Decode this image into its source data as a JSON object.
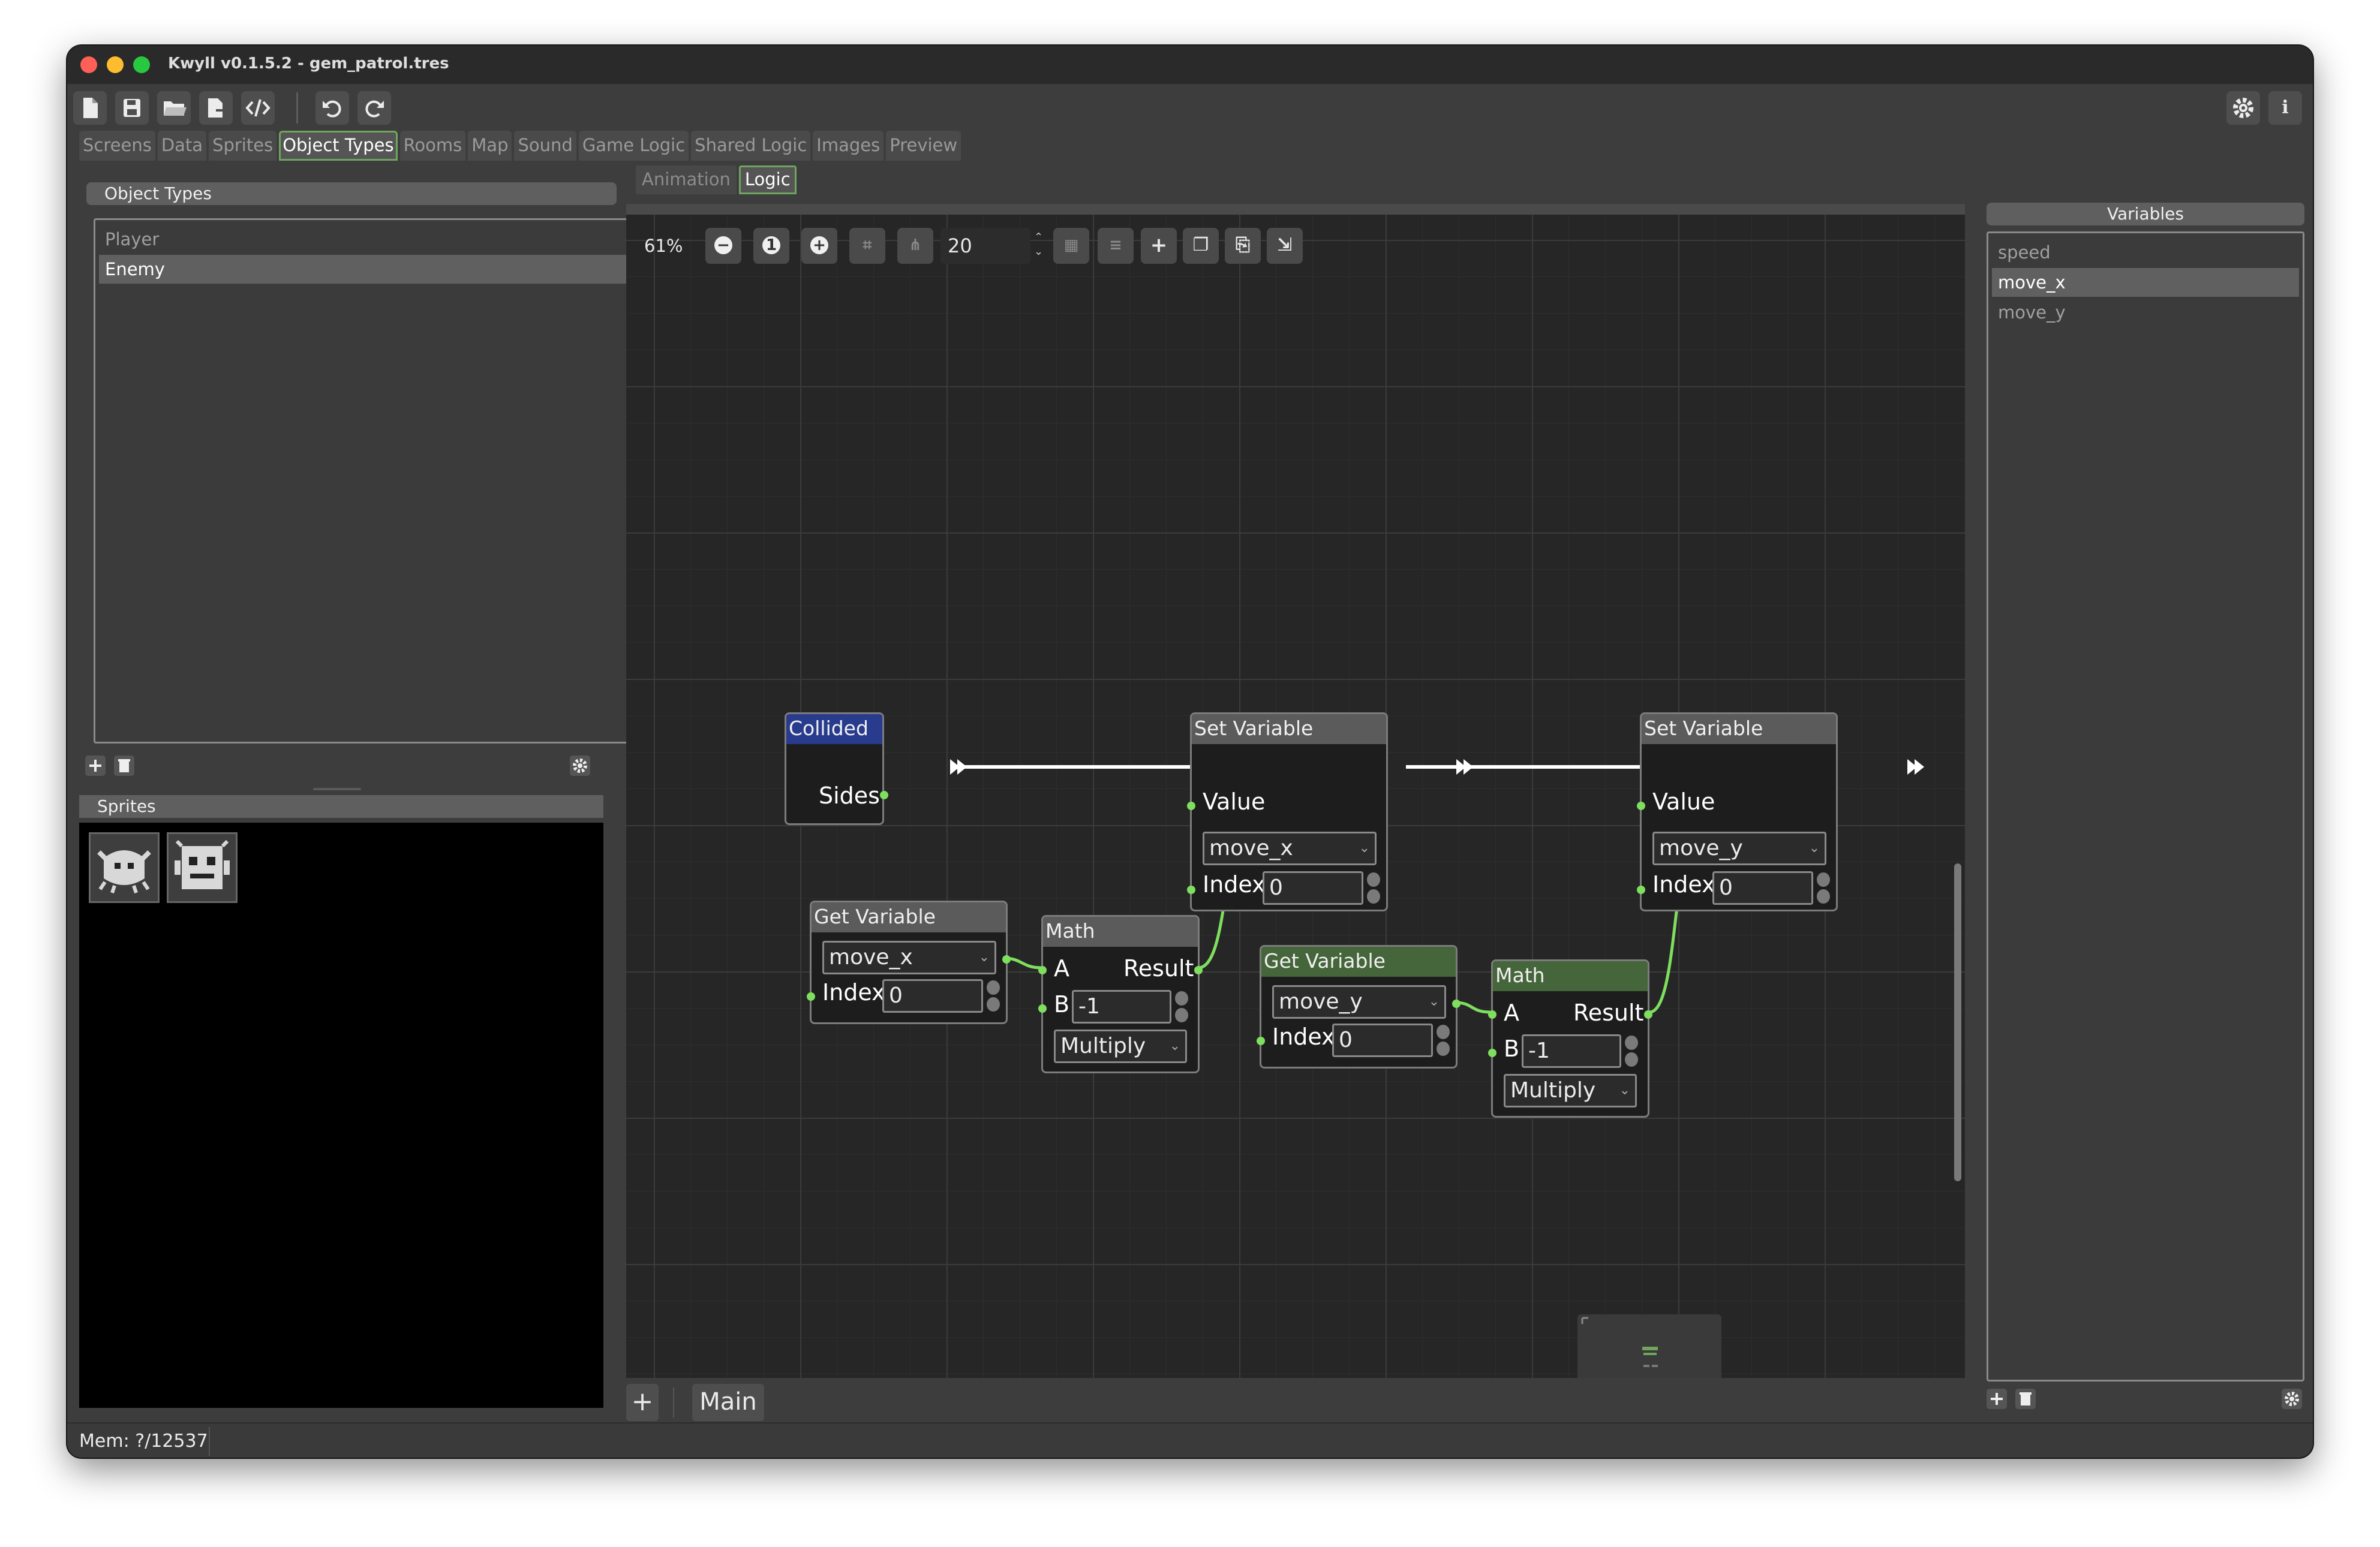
{
  "window": {
    "title": "Kwyll v0.1.5.2 - gem_patrol.tres"
  },
  "traffic_lights": {
    "close": "#fe5f57",
    "minimize": "#febc2e",
    "maximize": "#28c840"
  },
  "toolbar": {
    "icons": [
      "new-file-icon",
      "save-icon",
      "open-folder-icon",
      "export-icon",
      "code-icon",
      "undo-icon",
      "redo-icon",
      "settings-icon",
      "info-icon"
    ],
    "info_glyph": "i"
  },
  "main_tabs": [
    "Screens",
    "Data",
    "Sprites",
    "Object Types",
    "Rooms",
    "Map",
    "Sound",
    "Game Logic",
    "Shared Logic",
    "Images",
    "Preview"
  ],
  "active_main_tab": "Object Types",
  "object_types": {
    "header": "Object Types",
    "items": [
      "Player",
      "Enemy"
    ],
    "selected": "Enemy"
  },
  "sprites": {
    "header": "Sprites",
    "count": 2
  },
  "sub_tabs": [
    "Animation",
    "Logic"
  ],
  "active_sub_tab": "Logic",
  "canvas_toolbar": {
    "zoom": "61%",
    "snap_distance": "20"
  },
  "nodes": {
    "collided": {
      "title": "Collided",
      "port_sides": "Sides"
    },
    "set_variable_1": {
      "title": "Set Variable",
      "value_label": "Value",
      "variable": "move_x",
      "index_label": "Index",
      "index_value": "0"
    },
    "set_variable_2": {
      "title": "Set Variable",
      "value_label": "Value",
      "variable": "move_y",
      "index_label": "Index",
      "index_value": "0"
    },
    "get_variable_1": {
      "title": "Get Variable",
      "variable": "move_x",
      "index_label": "Index",
      "index_value": "0"
    },
    "get_variable_2": {
      "title": "Get Variable",
      "variable": "move_y",
      "index_label": "Index",
      "index_value": "0"
    },
    "math_1": {
      "title": "Math",
      "a_label": "A",
      "result_label": "Result",
      "b_label": "B",
      "b_value": "-1",
      "operation": "Multiply"
    },
    "math_2": {
      "title": "Math",
      "a_label": "A",
      "result_label": "Result",
      "b_label": "B",
      "b_value": "-1",
      "operation": "Multiply"
    }
  },
  "graph_tabs": {
    "add_label": "+",
    "tabs": [
      "Main"
    ]
  },
  "variables": {
    "header": "Variables",
    "items": [
      "speed",
      "move_x",
      "move_y"
    ],
    "selected": "move_x"
  },
  "status": {
    "memory": "Mem: ?/12537"
  },
  "colors": {
    "accent_green": "#6fa55f",
    "wire_green": "#7ede5e",
    "event_blue": "#283b8c",
    "get_green": "#45653a"
  }
}
